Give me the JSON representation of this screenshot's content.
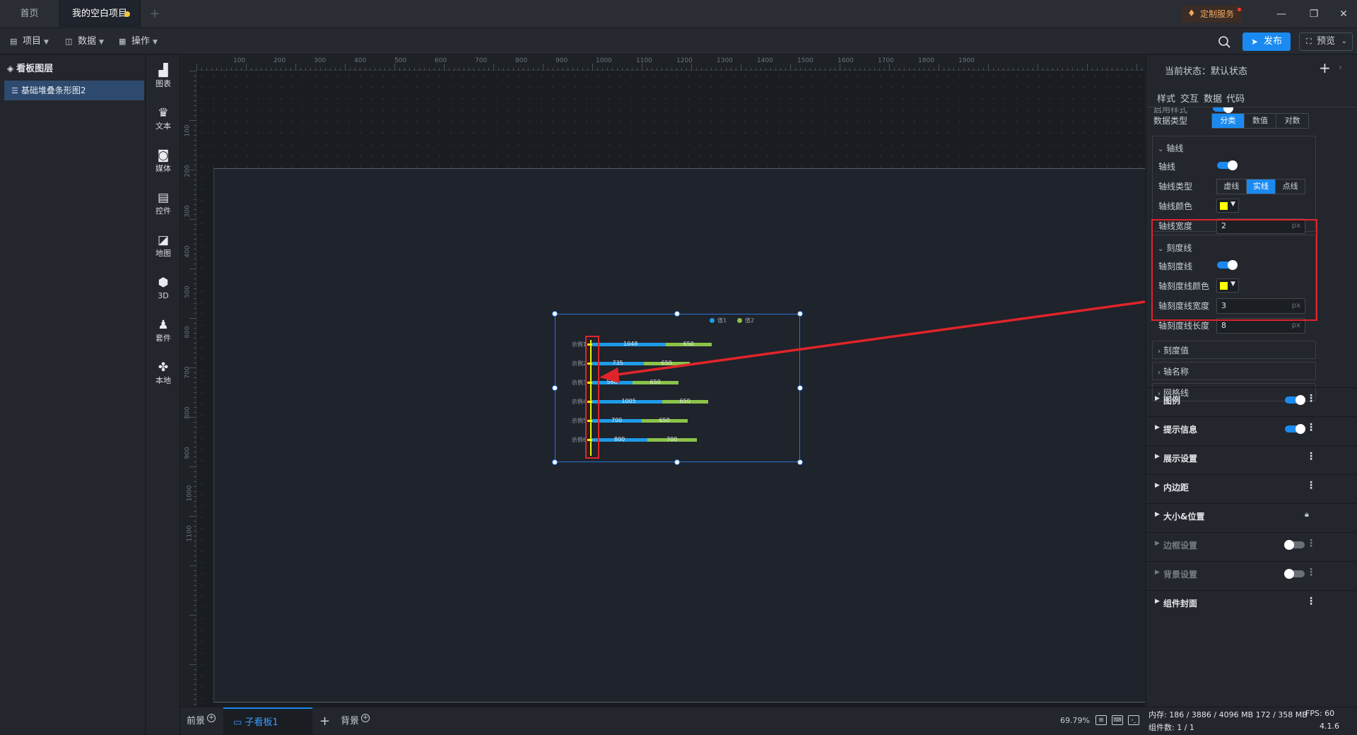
{
  "tabs": {
    "home": "首页",
    "project": "我的空白项目"
  },
  "window": {
    "custom_service": "定制服务",
    "minimize": "—",
    "restore": "❐",
    "close": "✕"
  },
  "toolbar": {
    "project": "项目",
    "data": "数据",
    "operate": "操作",
    "publish": "发布",
    "preview": "预览"
  },
  "layers": {
    "title": "看板图层",
    "item": "基础堆叠条形图2"
  },
  "dock": [
    {
      "icon": "chart-icon",
      "glyph": "▟",
      "label": "图表"
    },
    {
      "icon": "text-icon",
      "glyph": "♛",
      "label": "文本"
    },
    {
      "icon": "media-icon",
      "glyph": "◙",
      "label": "媒体"
    },
    {
      "icon": "control-icon",
      "glyph": "▤",
      "label": "控件"
    },
    {
      "icon": "map-icon",
      "glyph": "◪",
      "label": "地图"
    },
    {
      "icon": "3d-icon",
      "glyph": "⬢",
      "label": "3D"
    },
    {
      "icon": "kit-icon",
      "glyph": "♟",
      "label": "套件"
    },
    {
      "icon": "local-icon",
      "glyph": "✤",
      "label": "本地"
    }
  ],
  "rulers": {
    "h_labels": [
      "100",
      "200",
      "300",
      "400",
      "500",
      "600",
      "700",
      "800",
      "900",
      "1000",
      "1100",
      "1200",
      "1300",
      "1400",
      "1500",
      "1600",
      "1700",
      "1800",
      "1900"
    ],
    "v_labels": [
      "100",
      "200",
      "300",
      "400",
      "500",
      "600",
      "700",
      "800",
      "900",
      "1000",
      "1100"
    ]
  },
  "chart": {
    "legend": [
      "值1",
      "值2"
    ],
    "colors": {
      "series1": "#1e9be8",
      "series2": "#8bc34a",
      "axis": "#f5f500"
    },
    "rows": [
      {
        "label": "示例1",
        "v1": "1048",
        "v2": "650",
        "f1": 0.4,
        "f2": 0.25
      },
      {
        "label": "示例2",
        "v1": "735",
        "v2": "650",
        "f1": 0.28,
        "f2": 0.25
      },
      {
        "label": "示例3",
        "v1": "580",
        "v2": "650",
        "f1": 0.22,
        "f2": 0.25
      },
      {
        "label": "示例4",
        "v1": "1005",
        "v2": "650",
        "f1": 0.38,
        "f2": 0.25
      },
      {
        "label": "示例5",
        "v1": "700",
        "v2": "650",
        "f1": 0.27,
        "f2": 0.25
      },
      {
        "label": "示例6",
        "v1": "800",
        "v2": "700",
        "f1": 0.3,
        "f2": 0.27
      }
    ]
  },
  "bottom": {
    "foreground": "前景",
    "sub_board": "子看板1",
    "background": "背景",
    "zoom": "69.79%"
  },
  "props": {
    "state": "当前状态：默认状态",
    "tabs": [
      "样式",
      "交互",
      "数据",
      "代码"
    ],
    "cut_label": "启用样式",
    "data_type": {
      "label": "数据类型",
      "options": [
        "分类",
        "数值",
        "对数"
      ],
      "active": 0
    },
    "axis_line": {
      "title": "轴线",
      "toggle_label": "轴线",
      "type_label": "轴线类型",
      "type_options": [
        "虚线",
        "实线",
        "点线"
      ],
      "type_active": 1,
      "color_label": "轴线颜色",
      "width_label": "轴线宽度",
      "width_value": "2",
      "unit": "px"
    },
    "tick_line": {
      "title": "刻度线",
      "toggle_label": "轴刻度线",
      "color_label": "轴刻度线颜色",
      "width_label": "轴刻度线宽度",
      "width_value": "3",
      "length_label": "轴刻度线长度",
      "length_value": "8",
      "unit": "px"
    },
    "collapsed": [
      "刻度值",
      "轴名称",
      "网格线"
    ],
    "sections": [
      {
        "name": "图例",
        "control": "toggle-on"
      },
      {
        "name": "提示信息",
        "control": "toggle-on"
      },
      {
        "name": "展示设置",
        "control": "more"
      },
      {
        "name": "内边距",
        "control": "more"
      },
      {
        "name": "大小&位置",
        "control": "lock"
      },
      {
        "name": "边框设置",
        "control": "toggle-off"
      },
      {
        "name": "背景设置",
        "control": "toggle-off"
      },
      {
        "name": "组件封面",
        "control": "more"
      }
    ]
  },
  "status": {
    "memory": "内存: 186 / 3886 / 4096 MB  172 / 358 MB",
    "fps": "FPS: 60",
    "count": "组件数: 1 / 1",
    "version": "4.1.6"
  }
}
